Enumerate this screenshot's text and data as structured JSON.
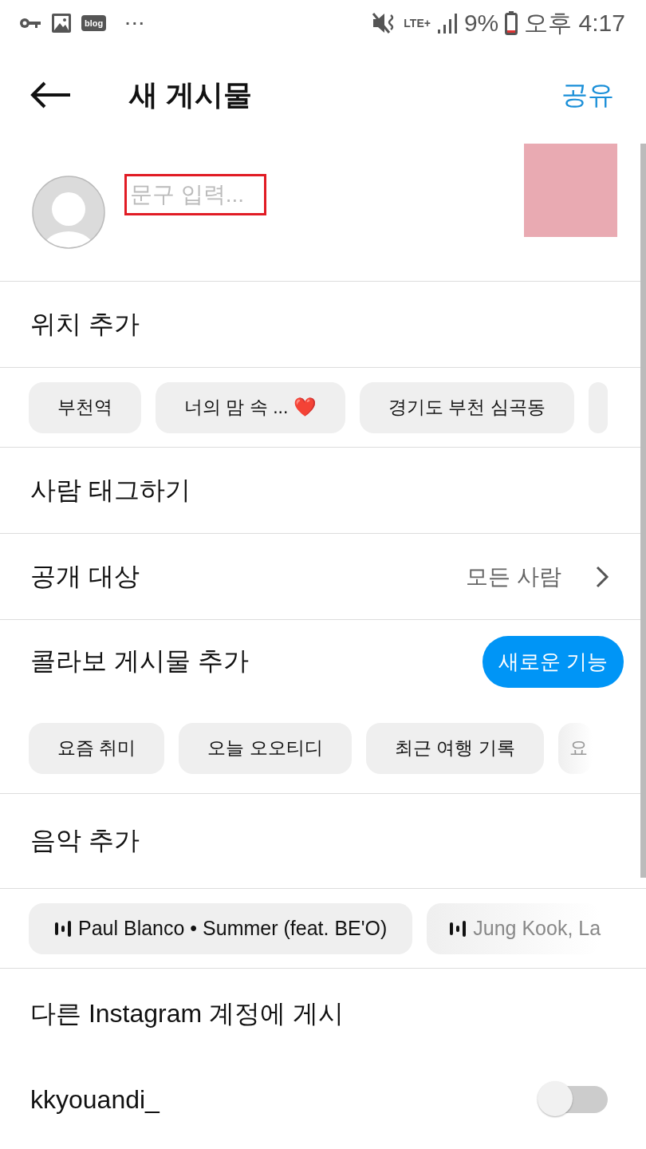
{
  "status_bar": {
    "blog_label": "blog",
    "more": "···",
    "network": "LTE+",
    "battery_text": "9%",
    "time": "오후 4:17"
  },
  "header": {
    "title": "새 게시물",
    "action": "공유"
  },
  "caption": {
    "placeholder": "문구 입력...",
    "highlighted": true
  },
  "location": {
    "label": "위치 추가",
    "suggestions": [
      {
        "label": "부천역"
      },
      {
        "label": "너의 맘 속 ... ❤️"
      },
      {
        "label": "경기도 부천 심곡동"
      }
    ]
  },
  "tag_people": {
    "label": "사람 태그하기"
  },
  "audience": {
    "label": "공개 대상",
    "value": "모든 사람"
  },
  "collab": {
    "label": "콜라보 게시물 추가",
    "badge": "새로운 기능",
    "suggestions": [
      {
        "label": "요즘 취미",
        "faded": false
      },
      {
        "label": "오늘 오오티디",
        "faded": false
      },
      {
        "label": "최근 여행 기록",
        "faded": false
      },
      {
        "label": "요",
        "faded": true
      }
    ]
  },
  "music": {
    "label": "음악 추가",
    "suggestions": [
      {
        "label": "Paul Blanco • Summer (feat. BE'O)",
        "faded": false
      },
      {
        "label": "Jung Kook, La",
        "faded": true
      }
    ]
  },
  "other_accounts": {
    "label": "다른 Instagram 계정에 게시",
    "accounts": [
      {
        "name": "kkyouandi_",
        "on": false
      }
    ]
  }
}
